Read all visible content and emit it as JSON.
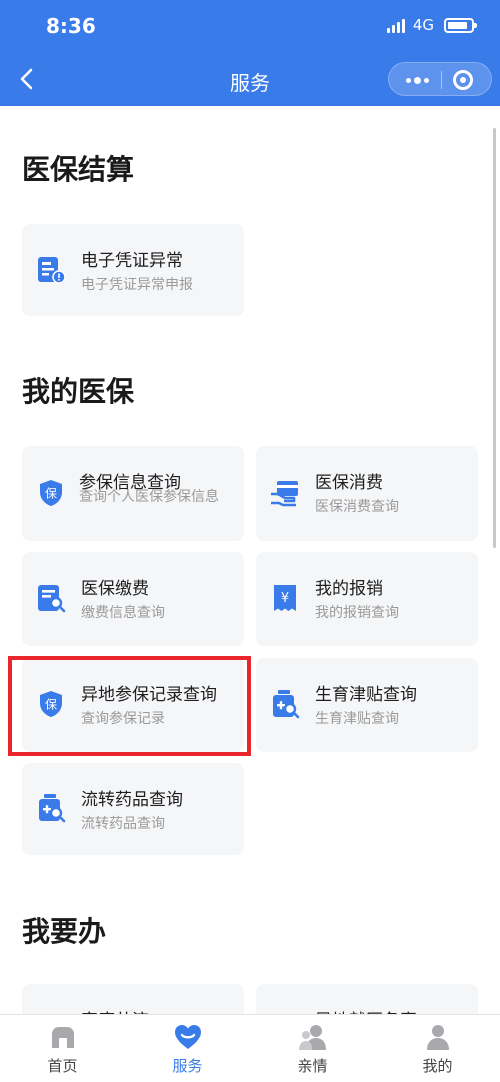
{
  "status_bar": {
    "time": "8:36",
    "network": "4G"
  },
  "nav": {
    "title": "服务"
  },
  "sections": [
    {
      "title": "医保结算"
    },
    {
      "title": "我的医保"
    },
    {
      "title": "我要办"
    }
  ],
  "cards": [
    {
      "title": "电子凭证异常",
      "subtitle": "电子凭证异常申报",
      "icon": "document-alert-icon"
    },
    {
      "title": "参保信息查询",
      "subtitle": "查询个人医保参保信息",
      "icon": "shield-bao-icon"
    },
    {
      "title": "医保消费",
      "subtitle": "医保消费查询",
      "icon": "card-hand-icon"
    },
    {
      "title": "医保缴费",
      "subtitle": "缴费信息查询",
      "icon": "document-search-icon"
    },
    {
      "title": "我的报销",
      "subtitle": "我的报销查询",
      "icon": "yuan-receipt-icon"
    },
    {
      "title": "异地参保记录查询",
      "subtitle": "查询参保记录",
      "icon": "shield-bao-icon"
    },
    {
      "title": "生育津贴查询",
      "subtitle": "生育津贴查询",
      "icon": "medicine-search-icon"
    },
    {
      "title": "流转药品查询",
      "subtitle": "流转药品查询",
      "icon": "medicine-search-icon"
    },
    {
      "title": "家庭共济",
      "subtitle": "",
      "icon": ""
    },
    {
      "title": "异地就医备案",
      "subtitle": "",
      "icon": ""
    }
  ],
  "tabs": [
    {
      "label": "首页",
      "icon": "home-icon",
      "active": false
    },
    {
      "label": "服务",
      "icon": "heart-service-icon",
      "active": true
    },
    {
      "label": "亲情",
      "icon": "family-icon",
      "active": false
    },
    {
      "label": "我的",
      "icon": "user-icon",
      "active": false
    }
  ],
  "colors": {
    "primary": "#3a7bea",
    "highlight": "#e8262b",
    "card_bg": "#f5f6f8"
  }
}
